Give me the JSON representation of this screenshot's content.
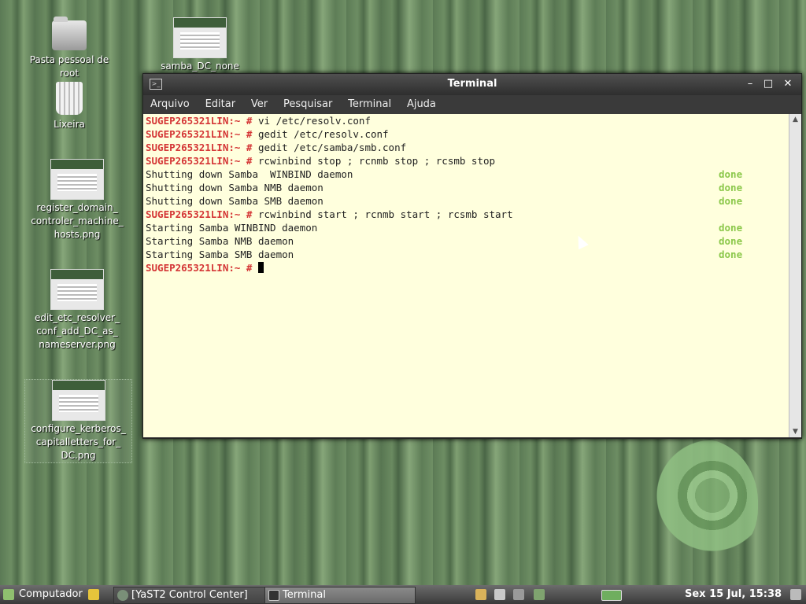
{
  "desktop": {
    "icons": [
      {
        "label": "Pasta pessoal de root"
      },
      {
        "label": "samba_DC_none"
      },
      {
        "label": "Lixeira"
      },
      {
        "label": "register_domain_ controler_machine_ hosts.png"
      },
      {
        "label": "edit_etc_resolver_ conf_add_DC_as_ nameserver.png"
      },
      {
        "label": "configure_kerberos_ capitalletters_for_ DC.png"
      }
    ]
  },
  "terminal": {
    "title": "Terminal",
    "menu": [
      "Arquivo",
      "Editar",
      "Ver",
      "Pesquisar",
      "Terminal",
      "Ajuda"
    ],
    "prompt": "SUGEP265321LIN:~ #",
    "lines": [
      {
        "cmd": " vi /etc/resolv.conf"
      },
      {
        "cmd": " gedit /etc/resolv.conf"
      },
      {
        "cmd": " gedit /etc/samba/smb.conf"
      },
      {
        "cmd": " rcwinbind stop ; rcnmb stop ; rcsmb stop"
      },
      {
        "text": "Shutting down Samba  WINBIND daemon",
        "status": "done"
      },
      {
        "text": "Shutting down Samba NMB daemon",
        "status": "done"
      },
      {
        "text": "Shutting down Samba SMB daemon",
        "status": "done"
      },
      {
        "cmd": " rcwinbind start ; rcnmb start ; rcsmb start"
      },
      {
        "text": "Starting Samba WINBIND daemon",
        "status": "done"
      },
      {
        "text": "Starting Samba NMB daemon",
        "status": "done"
      },
      {
        "text": "Starting Samba SMB daemon",
        "status": "done"
      },
      {
        "cmd": " "
      }
    ]
  },
  "taskbar": {
    "start_label": "Computador",
    "tasks": [
      "[YaST2 Control Center]",
      "Terminal"
    ],
    "clock": "Sex 15 Jul, 15:38"
  },
  "colors": {
    "prompt": "#d43535",
    "done": "#8cc84b",
    "terminal_bg": "#ffffdd"
  }
}
